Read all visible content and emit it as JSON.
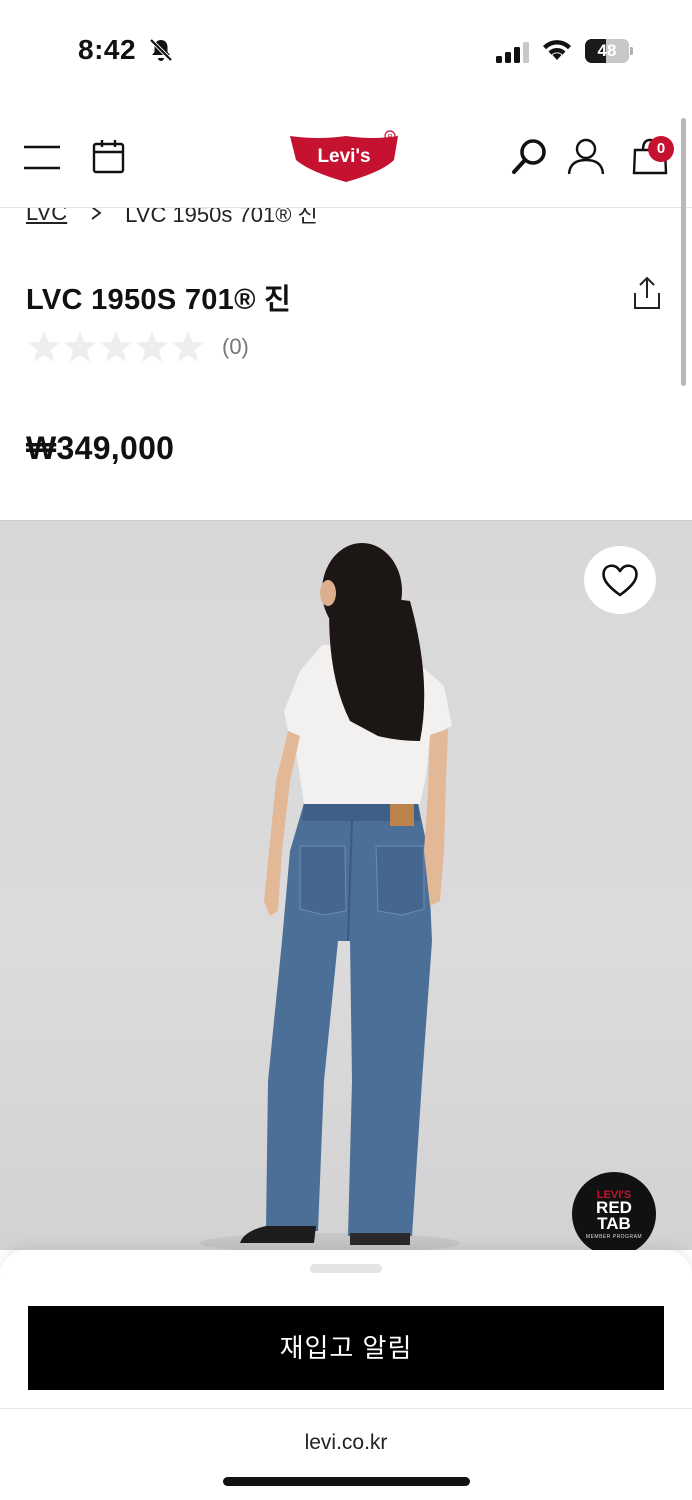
{
  "status_bar": {
    "time": "8:42",
    "battery_level": "48",
    "icons": [
      "bell-slash-icon",
      "signal-icon",
      "wifi-icon",
      "battery-icon"
    ]
  },
  "header": {
    "logo_text": "Levi's",
    "cart_count": "0",
    "icons": [
      "menu-icon",
      "calendar-icon",
      "search-icon",
      "user-icon",
      "cart-icon"
    ]
  },
  "breadcrumb": {
    "items": [
      "LVC",
      "LVC 1950s 701® 진"
    ]
  },
  "product": {
    "title": "LVC 1950S 701® 진",
    "rating": 0,
    "rating_max": 5,
    "review_count": "(0)",
    "price": "₩349,000"
  },
  "badge": {
    "brand": "LEVI'S",
    "line1": "RED",
    "line2": "TAB",
    "sub": "MEMBER PROGRAM"
  },
  "sheet": {
    "button_label": "재입고 알림"
  },
  "browser": {
    "url": "levi.co.kr"
  },
  "colors": {
    "brand_red": "#c41230",
    "button_black": "#000000",
    "image_bg": "#d9d8d9"
  }
}
